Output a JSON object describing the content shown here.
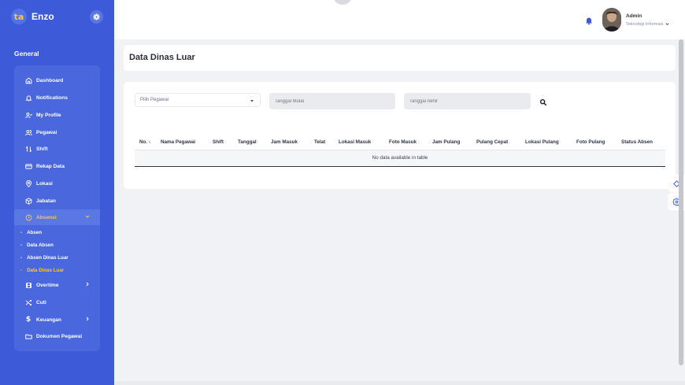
{
  "brand": {
    "logo_text": "ta",
    "name": "Enzo"
  },
  "sidebar": {
    "section": "General",
    "items": [
      {
        "label": "Dashboard",
        "icon": "home-icon"
      },
      {
        "label": "Notifications",
        "icon": "bell-icon"
      },
      {
        "label": "My Profile",
        "icon": "user-icon"
      },
      {
        "label": "Pegawai",
        "icon": "users-icon"
      },
      {
        "label": "Shift",
        "icon": "swap-icon"
      },
      {
        "label": "Rekap Data",
        "icon": "card-icon"
      },
      {
        "label": "Lokasi",
        "icon": "location-icon"
      },
      {
        "label": "Jabatan",
        "icon": "box-icon"
      },
      {
        "label": "Absensi",
        "icon": "clock-icon"
      },
      {
        "label": "Overtime",
        "icon": "film-icon"
      },
      {
        "label": "Cuti",
        "icon": "shuffle-icon"
      },
      {
        "label": "Keuangan",
        "icon": "dollar-icon"
      },
      {
        "label": "Dokumen Pegawai",
        "icon": "folder-icon"
      }
    ],
    "sub_items": [
      {
        "label": "Absen"
      },
      {
        "label": "Data Absen"
      },
      {
        "label": "Absen Dinas Luar"
      },
      {
        "label": "Data Dinas Luar"
      }
    ],
    "dash": "-"
  },
  "user": {
    "name": "Admin",
    "role": "Teknologi Informasi"
  },
  "page": {
    "title": "Data Dinas Luar"
  },
  "filters": {
    "pegawai_placeholder": "Pilih Pegawai",
    "start_placeholder": "Tanggal Mulai",
    "end_placeholder": "Tanggal Akhir"
  },
  "table": {
    "columns": [
      "No.",
      "Nama Pegawai",
      "Shift",
      "Tanggal",
      "Jam Masuk",
      "Telat",
      "Lokasi Masuk",
      "Foto Masuk",
      "Jam Pulang",
      "Pulang Cepat",
      "Lokasi Pulang",
      "Foto Pulang",
      "Status Absen"
    ],
    "empty_message": "No data available in table"
  },
  "colors": {
    "sidebar": "#3d5bd8",
    "accent": "#f7c744",
    "background": "#f1f2f6"
  }
}
